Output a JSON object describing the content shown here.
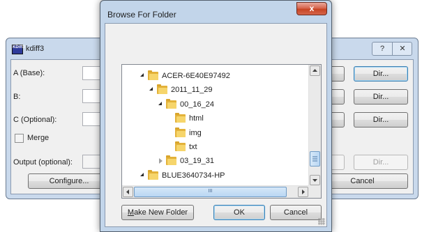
{
  "kdiff3": {
    "title": "kdiff3",
    "icon_text": "KDiff3",
    "help_glyph": "?",
    "close_glyph": "✕",
    "labels": {
      "a_base": "A (Base):",
      "b": "B:",
      "c_optional": "C (Optional):",
      "merge": "Merge",
      "output_optional": "Output (optional):"
    },
    "file_button_partial": "e...",
    "dir_button": "Dir...",
    "configure_button": "Configure...",
    "cancel_button": "Cancel"
  },
  "browse_dialog": {
    "title": "Browse For Folder",
    "close_glyph": "x",
    "tree": [
      {
        "label": "ACER-6E40E97492",
        "level": 0,
        "expanded": true
      },
      {
        "label": "2011_11_29",
        "level": 1,
        "expanded": true
      },
      {
        "label": "00_16_24",
        "level": 2,
        "expanded": true
      },
      {
        "label": "html",
        "level": 3,
        "expanded": null
      },
      {
        "label": "img",
        "level": 3,
        "expanded": null
      },
      {
        "label": "txt",
        "level": 3,
        "expanded": null
      },
      {
        "label": "03_19_31",
        "level": 2,
        "expanded": false
      },
      {
        "label": "BLUE3640734-HP",
        "level": 0,
        "expanded": true
      }
    ],
    "hscroll_grip": "III",
    "make_new_folder": {
      "mnemonic": "M",
      "rest": "ake New Folder"
    },
    "ok_button": "OK",
    "cancel_button": "Cancel"
  }
}
